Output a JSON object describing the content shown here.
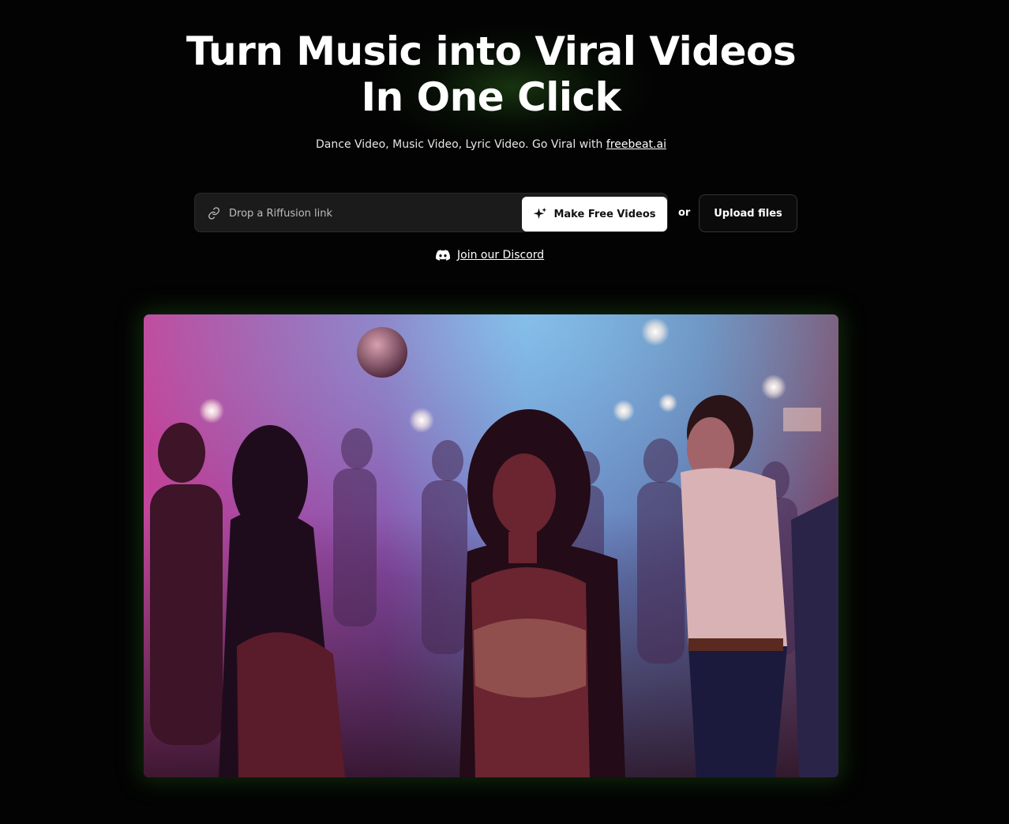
{
  "hero": {
    "title_line1": "Turn Music into Viral Videos",
    "title_line2": "In One Click",
    "subtitle_text": "Dance Video, Music Video, Lyric Video. Go Viral with ",
    "subtitle_link": "freebeat.ai"
  },
  "input": {
    "placeholder": "Drop a Riffusion link",
    "value": "",
    "icon": "link-icon"
  },
  "buttons": {
    "make_label": "Make Free Videos",
    "make_icon": "sparkle-icon",
    "or_label": "or",
    "upload_label": "Upload files"
  },
  "discord": {
    "label": "Join our Discord",
    "icon": "discord-icon"
  },
  "media": {
    "description_icon": "video-preview",
    "glow_color": "#2f7a22"
  },
  "colors": {
    "background": "#030303",
    "primary_button_bg": "#ffffff",
    "input_bg": "#1b1b1b"
  }
}
